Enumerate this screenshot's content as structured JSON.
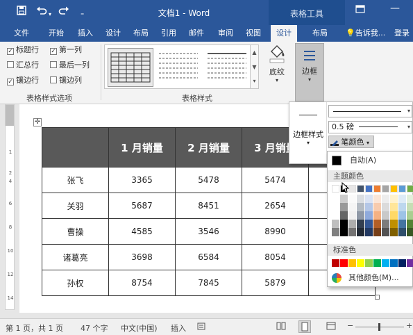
{
  "titlebar": {
    "save_icon": "save-icon",
    "undo_icon": "undo-icon",
    "redo_icon": "redo-icon",
    "customize_icon": "customize-quick-access-icon",
    "title": "文档1 - Word",
    "context_tab": "表格工具",
    "ribbon_display_icon": "ribbon-display-options-icon",
    "minimize_icon": "minimize-icon"
  },
  "tabs": {
    "file": "文件",
    "home": "开始",
    "insert": "插入",
    "design": "设计",
    "layout": "布局",
    "references": "引用",
    "mailings": "邮件",
    "review": "审阅",
    "view": "视图",
    "table_design": "设计",
    "table_layout": "布局",
    "tell_me": "告诉我...",
    "signin": "登录"
  },
  "ribbon": {
    "options": {
      "header_row": {
        "label": "标题行",
        "checked": true
      },
      "first_column": {
        "label": "第一列",
        "checked": true
      },
      "total_row": {
        "label": "汇总行",
        "checked": false
      },
      "last_column": {
        "label": "最后一列",
        "checked": false
      },
      "banded_rows": {
        "label": "镶边行",
        "checked": true
      },
      "banded_columns": {
        "label": "镶边列",
        "checked": false
      },
      "group_label": "表格样式选项"
    },
    "styles_group_label": "表格样式",
    "shading_label": "底纹",
    "borders_label": "边框"
  },
  "border_popup": {
    "border_styles_label": "边框样式",
    "line_weight": "0.5 磅",
    "pen_color_label": "笔颜色"
  },
  "color_panel": {
    "automatic_label": "自动(A)",
    "theme_colors_label": "主题颜色",
    "standard_colors_label": "标准色",
    "more_colors_label": "其他颜色(M)...",
    "theme_top_row": [
      "#ffffff",
      "#000000",
      "#e7e6e6",
      "#44546a",
      "#4472c4",
      "#ed7d31",
      "#a5a5a5",
      "#ffc000",
      "#5b9bd5",
      "#70ad47"
    ],
    "standard_colors": [
      "#c00000",
      "#ff0000",
      "#ffc000",
      "#ffff00",
      "#92d050",
      "#00b050",
      "#00b0f0",
      "#0070c0",
      "#002060",
      "#7030a0"
    ]
  },
  "table": {
    "headers": [
      "",
      "1 月销量",
      "2 月销量",
      "3 月销量"
    ],
    "rows": [
      [
        "张飞",
        "3365",
        "5478",
        "5474"
      ],
      [
        "关羽",
        "5687",
        "8451",
        "2654"
      ],
      [
        "曹操",
        "4585",
        "3546",
        "8990"
      ],
      [
        "诸葛亮",
        "3698",
        "6584",
        "8054"
      ],
      [
        "孙权",
        "8754",
        "7845",
        "5879"
      ]
    ]
  },
  "ruler_numbers": [
    "1",
    "2",
    "4",
    "6",
    "8",
    "10",
    "12",
    "14"
  ],
  "statusbar": {
    "page": "第 1 页，共 1 页",
    "words": "47 个字",
    "language": "中文(中国)",
    "insert_mode": "插入"
  }
}
